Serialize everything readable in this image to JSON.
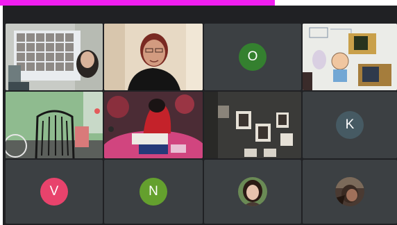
{
  "banner": {
    "text": "",
    "color": "#f01ef0"
  },
  "participants": {
    "o": {
      "initial": "O",
      "color": "#34802f"
    },
    "k": {
      "initial": "K",
      "color": "#465a63"
    },
    "v": {
      "initial": "V",
      "color": "#e8436c"
    },
    "n": {
      "initial": "N",
      "color": "#64a02e"
    }
  },
  "colors": {
    "meeting_bg": "#202124",
    "tile_bg": "#3c4043"
  }
}
